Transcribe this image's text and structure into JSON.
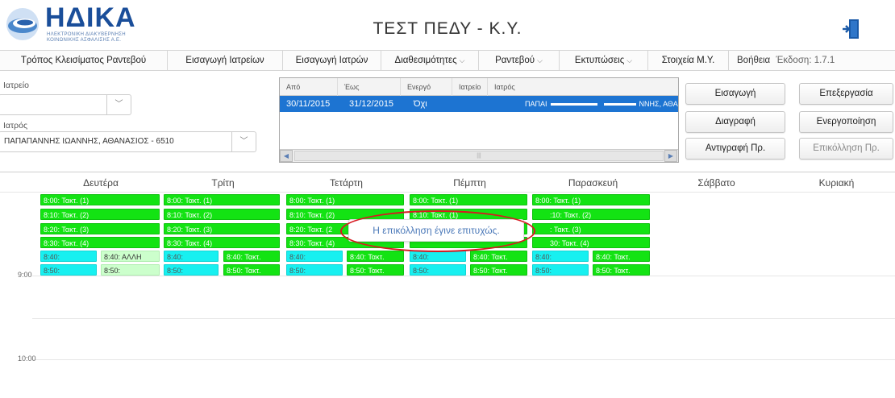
{
  "header": {
    "logo_name": "ΗΔΙΚΑ",
    "logo_sub_line1": "ΗΛΕΚΤΡΟΝΙΚΗ ΔΙΑΚΥΒΕΡΝΗΣΗ",
    "logo_sub_line2": "ΚΟΙΝΩΝΙΚΗΣ ΑΣΦΑΛΙΣΗΣ Α.Ε.",
    "title": "ΤΕΣΤ ΠΕΔΥ - Κ.Υ.",
    "exit_icon": "logout-door-icon"
  },
  "nav": {
    "items": [
      {
        "label": "Τρόπος Κλεισίματος Ραντεβού",
        "caret": ""
      },
      {
        "label": "Εισαγωγή Ιατρείων",
        "caret": ""
      },
      {
        "label": "Εισαγωγή Ιατρών",
        "caret": ""
      },
      {
        "label": "Διαθεσιμότητες",
        "caret": "⌵"
      },
      {
        "label": "Ραντεβού",
        "caret": "⌵"
      },
      {
        "label": "Εκτυπώσεις",
        "caret": "⌵"
      },
      {
        "label": "Στοιχεία Μ.Υ.",
        "caret": ""
      }
    ],
    "help": "Βοήθεια",
    "version": "Έκδοση: 1.7.1"
  },
  "filters": {
    "office_label": "Ιατρείο",
    "office_value": "",
    "doctor_label": "Ιατρός",
    "doctor_value": "ΠΑΠΑΠΑΝΝΗΣ ΙΩΑΝΝΗΣ, ΑΘΑΝΑΣΙΟΣ - 6510"
  },
  "availability": {
    "columns": [
      "Από",
      "Έως",
      "Ενεργό",
      "Ιατρείο",
      "Ιατρός"
    ],
    "rows": [
      {
        "from": "30/11/2015",
        "to": "31/12/2015",
        "active": "Όχι",
        "office": "",
        "doctor_a": "ΠΑΠΑΙ",
        "doctor_b": "ΝΝΗΣ, ΑΘΑΙ"
      }
    ],
    "scroll_left": "◀",
    "scroll_right": "▶",
    "scroll_grip": "|||"
  },
  "buttons": {
    "insert": "Εισαγωγή",
    "edit": "Επεξεργασία",
    "delete": "Διαγραφή",
    "activate": "Ενεργοποίηση",
    "copy": "Αντιγραφή Πρ.",
    "paste": "Επικόλληση Πρ."
  },
  "calendar": {
    "days": [
      "Δευτέρα",
      "Τρίτη",
      "Τετάρτη",
      "Πέμπτη",
      "Παρασκευή",
      "Σάββατο",
      "Κυριακή"
    ],
    "times": [
      "9:00",
      "10:00"
    ],
    "monday": {
      "rows": [
        "8:00: Τακτ. (1)",
        "8:10: Τακτ. (2)",
        "8:20: Τακτ. (3)",
        "8:30: Τακτ. (4)"
      ],
      "r840a": "8:40:",
      "r840b": "8:40: ΑΛΛΗ",
      "r850a": "8:50:",
      "r850b": "8:50:"
    },
    "tuesday": {
      "rows": [
        "8:00: Τακτ. (1)",
        "8:10: Τακτ. (2)",
        "8:20: Τακτ. (3)",
        "8:30: Τακτ. (4)"
      ],
      "r840a": "8:40:",
      "r840b": "8:40: Τακτ.",
      "r850a": "8:50:",
      "r850b": "8:50: Τακτ."
    },
    "wednesday": {
      "rows": [
        "8:00: Τακτ. (1)",
        "8:10: Τακτ. (2)",
        "8:20: Τακτ. (2",
        "8:30: Τακτ. (4)"
      ],
      "r840a": "8:40:",
      "r840b": "8:40: Τακτ.",
      "r850a": "8:50:",
      "r850b": "8:50: Τακτ."
    },
    "thursday": {
      "rows": [
        "8:00: Τακτ. (1)",
        "8:10: Τακτ. (1)"
      ],
      "r840a": "8:40:",
      "r840b": "8:40: Τακτ.",
      "r850a": "8:50:",
      "r850b": "8:50: Τακτ."
    },
    "friday": {
      "rows": [
        "8:00: Τακτ. (1)",
        ":10: Τακτ. (2)",
        ": Τακτ. (3)",
        "30: Τακτ. (4)"
      ],
      "r840a": "8:40:",
      "r840b": "8:40: Τακτ.",
      "r850a": "8:50:",
      "r850b": "8:50: Τακτ."
    }
  },
  "toast": {
    "message": "Η επικόλληση έγινε επιτυχώς."
  },
  "colors": {
    "slot_green": "#13e313",
    "slot_cyan": "#17f0f0",
    "slot_pale": "#ccffcc",
    "selected_row": "#1d74d2",
    "annotation_ring": "#d71920"
  }
}
